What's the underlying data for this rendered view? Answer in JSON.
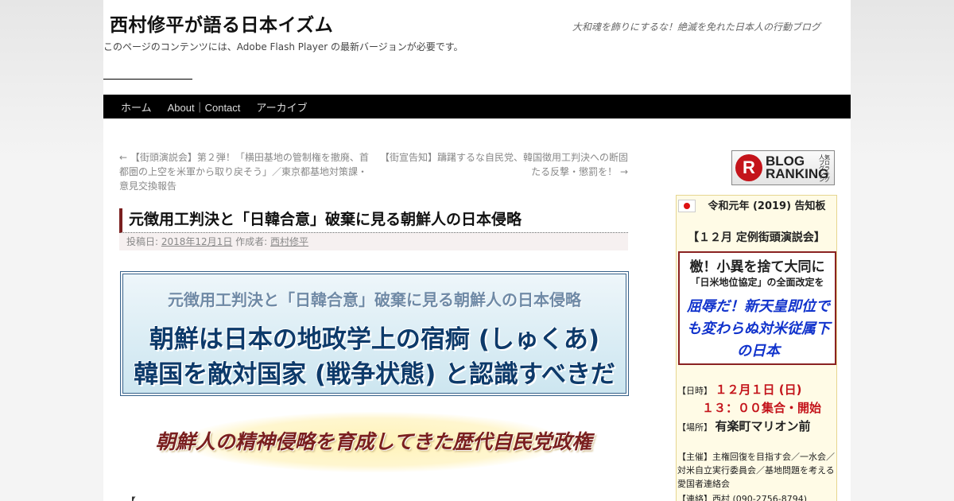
{
  "header": {
    "site_title": "西村修平が語る日本イズム",
    "site_description": "大和魂を飾りにするな！絶滅を免れた日本人の行動ブログ",
    "flash_note": "このページのコンテンツには、Adobe Flash Player の最新バージョンが必要です。"
  },
  "nav": {
    "items": [
      {
        "label": "ホーム"
      },
      {
        "label": "About｜Contact"
      },
      {
        "label": "アーカイブ"
      }
    ]
  },
  "post_nav": {
    "prev": "← 【街頭演説会】第２弾！「横田基地の管制権を撤廃、首都圏の上空を米軍から取り戻そう」／東京都基地対策課・意見交換報告",
    "next": "【街宣告知】躊躇するな自民党、韓国徴用工判決への断固たる反撃・懲罰を！ →"
  },
  "post": {
    "title": "元徴用工判決と「日韓合意」破棄に見る朝鮮人の日本侵略",
    "meta_posted_label": "投稿日:",
    "meta_date": "2018年12月1日",
    "meta_author_label": "作成者:",
    "meta_author": "西村修平",
    "banner1_sub": "元徴用工判決と「日韓合意」破棄に見る朝鮮人の日本侵略",
    "banner1_line1": "朝鮮は日本の地政学上の宿痾 (しゅくあ)",
    "banner1_line2": "韓国を敵対国家 (戦争状態) と認識すべきだ",
    "banner2_text": "朝鮮人の精神侵略を育成してきた歴代自民党政権",
    "next_section": "【"
  },
  "sidebar": {
    "ranking": {
      "logo_letter": "R",
      "line1": "BLOG",
      "line2": "RANKING",
      "small": "人気ブログランキング"
    },
    "notice_title": "令和元年 (2019) 告知板",
    "event_title": "【１２月 定例街頭演説会】",
    "theme_line1": "檄！小異を捨て大同に",
    "theme_line2": "「日米地位協定」の全面改定を",
    "theme_line3": "屈辱だ！新天皇即位でも変わらぬ対米従属下の日本",
    "date_label": "【日時】",
    "date_value": "１２月１日 (日)",
    "time_value": "１３：００集合・開始",
    "place_label": "【場所】",
    "place_value": "有楽町マリオン前",
    "organizer": "【主催】主権回復を目指す会／一水会／対米自立実行委員会／基地問題を考える愛国者連絡会",
    "contact": "【連絡】西村 (090-2756-8794)"
  }
}
